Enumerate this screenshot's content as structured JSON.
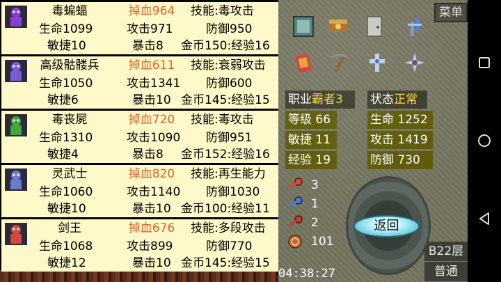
{
  "monsters": [
    {
      "name": "毒蝙蝠",
      "damage": "掉血964",
      "skill": "技能:毒攻击",
      "hp": "生命1099",
      "atk": "攻击971",
      "def": "防御950",
      "agi": "敏捷10",
      "crit": "暴击8",
      "reward": "金币150:经验16",
      "icon": "bat-icon",
      "color": "#8a3fd0"
    },
    {
      "name": "高级骷髅兵",
      "damage": "掉血611",
      "skill": "技能:衰弱攻击",
      "hp": "生命1050",
      "atk": "攻击1341",
      "def": "防御600",
      "agi": "敏捷6",
      "crit": "暴击10",
      "reward": "金币145:经验15",
      "icon": "skeleton-icon",
      "color": "#7a5bd6"
    },
    {
      "name": "毒丧屍",
      "damage": "掉血720",
      "skill": "技能:毒攻击",
      "hp": "生命1310",
      "atk": "攻击1090",
      "def": "防御951",
      "agi": "敏捷4",
      "crit": "暴击8",
      "reward": "金币152:经验16",
      "icon": "zombie-icon",
      "color": "#3fa83a"
    },
    {
      "name": "灵武士",
      "damage": "掉血820",
      "skill": "技能:再生能力",
      "hp": "生命1060",
      "atk": "攻击1140",
      "def": "防御1030",
      "agi": "敏捷10",
      "crit": "暴击10",
      "reward": "金币100:经验11",
      "icon": "armored-knight-icon",
      "color": "#6a7acf"
    },
    {
      "name": "剑王",
      "damage": "掉血676",
      "skill": "技能:多段攻击",
      "hp": "生命1068",
      "atk": "攻击899",
      "def": "防御770",
      "agi": "敏捷12",
      "crit": "暴击10",
      "reward": "金币145:经验15",
      "icon": "sword-king-icon",
      "color": "#d04a3a"
    }
  ],
  "panel": {
    "menu_label": "菜单",
    "class_label": "职业",
    "class_value": "霸者3",
    "status_label": "状态",
    "status_value": "正常",
    "level": "等级 66",
    "agility": "敏捷 11",
    "exp": "经验 19",
    "hp": "生命 1252",
    "attack": "攻击 1419",
    "defense": "防御 730",
    "keys": [
      {
        "icon": "yellow-key-icon",
        "count": "3",
        "color": "#d8b23a"
      },
      {
        "icon": "blue-key-icon",
        "count": "1",
        "color": "#4a78d8"
      },
      {
        "icon": "red-key-icon",
        "count": "2",
        "color": "#d84a3a"
      },
      {
        "icon": "coin-icon",
        "count": "101",
        "color": "#c88a3a"
      }
    ],
    "back_label": "返回",
    "floor_label": "B22层",
    "mode_label": "普通",
    "clock": "04:38:27"
  }
}
